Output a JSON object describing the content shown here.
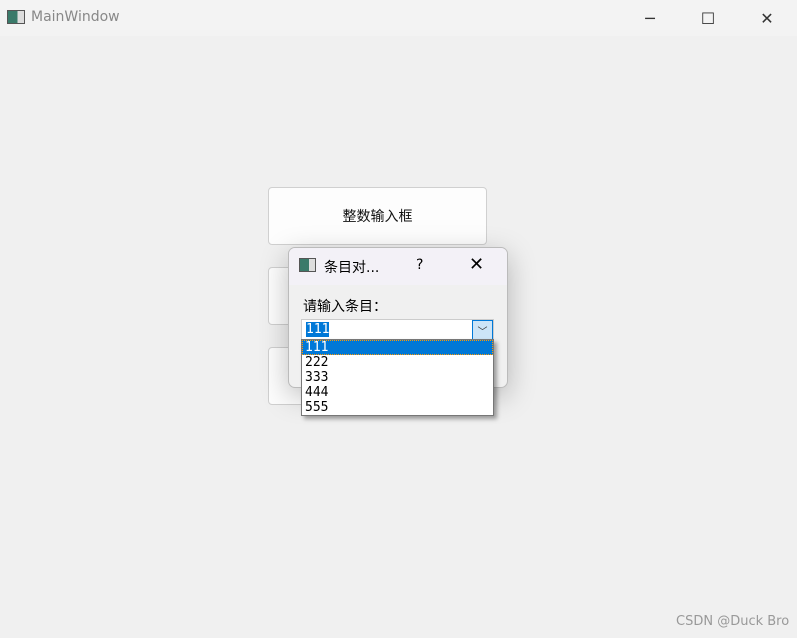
{
  "window": {
    "title": "MainWindow",
    "icon": "app-window-icon",
    "controls": [
      "minimize-icon",
      "maximize-icon",
      "close-icon"
    ]
  },
  "buttons": [
    {
      "label": "整数输入框"
    },
    {
      "label": ""
    },
    {
      "label": ""
    }
  ],
  "dialog": {
    "title": "条目对...",
    "help": "?",
    "close": "✕",
    "prompt": "请输入条目：",
    "combo": {
      "value": "111",
      "options": [
        "111",
        "222",
        "333",
        "444",
        "555"
      ],
      "selected_index": 0
    }
  },
  "watermark": "CSDN @Duck Bro",
  "colors": {
    "accent": "#0078d7"
  }
}
